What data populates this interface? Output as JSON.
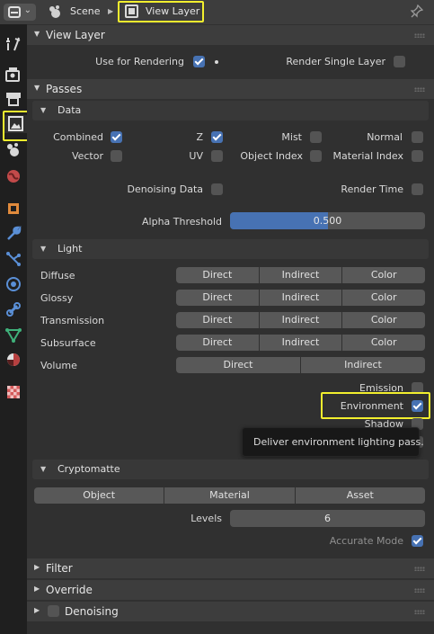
{
  "header": {
    "breadcrumb_scene": "Scene",
    "breadcrumb_view_layer": "View Layer"
  },
  "panels": {
    "view_layer": {
      "title": "View Layer",
      "use_for_rendering": "Use for Rendering",
      "render_single_layer": "Render Single Layer"
    },
    "passes": {
      "title": "Passes",
      "data": {
        "title": "Data",
        "combined": "Combined",
        "z": "Z",
        "mist": "Mist",
        "normal": "Normal",
        "vector": "Vector",
        "uv": "UV",
        "object_index": "Object Index",
        "material_index": "Material Index",
        "denoising_data": "Denoising Data",
        "render_time": "Render Time",
        "alpha_threshold": "Alpha Threshold",
        "alpha_threshold_value": "0.500",
        "alpha_threshold_fraction": 0.5
      },
      "light": {
        "title": "Light",
        "rows": [
          {
            "label": "Diffuse"
          },
          {
            "label": "Glossy"
          },
          {
            "label": "Transmission"
          },
          {
            "label": "Subsurface"
          }
        ],
        "volume": "Volume",
        "direct": "Direct",
        "indirect": "Indirect",
        "color": "Color",
        "emission": "Emission",
        "environment": "Environment",
        "shadow": "Shadow",
        "tooltip": "Deliver environment lighting pass."
      },
      "cryptomatte": {
        "title": "Cryptomatte",
        "object": "Object",
        "material": "Material",
        "asset": "Asset",
        "levels": "Levels",
        "levels_value": "6",
        "accurate_mode": "Accurate Mode"
      }
    },
    "filter": {
      "title": "Filter"
    },
    "override": {
      "title": "Override"
    },
    "denoising": {
      "title": "Denoising"
    }
  },
  "colors": {
    "accent": "#4772b3",
    "highlight": "#f2ef2e",
    "panel_bg": "#303030",
    "header_bg": "#3d3d3d",
    "tabbar_bg": "#1f1f1f"
  },
  "icons": [
    "editor-type-icon",
    "scene-icon",
    "view-layer-icon",
    "pin-icon",
    "tool-icon",
    "render-icon",
    "output-icon",
    "view-layer-tab-icon",
    "scene-tab-icon",
    "world-icon",
    "object-icon",
    "modifier-icon",
    "particles-icon",
    "physics-icon",
    "constraints-icon",
    "data-icon",
    "material-icon",
    "texture-icon"
  ]
}
